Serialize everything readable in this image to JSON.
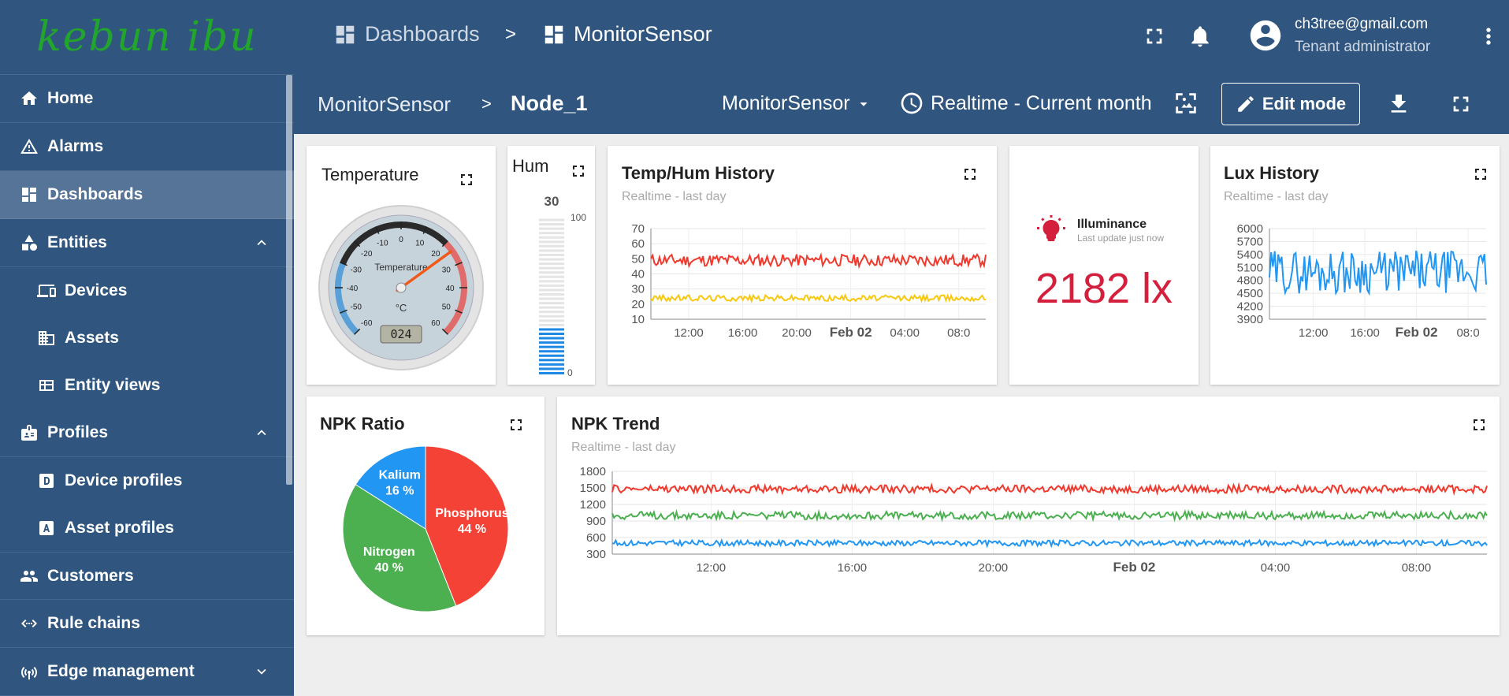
{
  "app": {
    "logo_text": "kebun ibu",
    "colors": {
      "primary": "#305680",
      "accent_red": "#d41f3d",
      "series_red": "#f03a2e",
      "series_yellow": "#f7c80e",
      "series_blue": "#2196f3",
      "series_green": "#4caf50"
    }
  },
  "sidebar": {
    "items": [
      {
        "label": "Home",
        "icon": "home-icon"
      },
      {
        "label": "Alarms",
        "icon": "warning-icon"
      },
      {
        "label": "Dashboards",
        "icon": "dashboard-icon"
      },
      {
        "label": "Entities",
        "icon": "entities-icon"
      },
      {
        "label": "Devices",
        "icon": "devices-icon"
      },
      {
        "label": "Assets",
        "icon": "assets-icon"
      },
      {
        "label": "Entity views",
        "icon": "entity-views-icon"
      },
      {
        "label": "Profiles",
        "icon": "profiles-icon"
      },
      {
        "label": "Device profiles",
        "icon": "device-profile-icon"
      },
      {
        "label": "Asset profiles",
        "icon": "asset-profile-icon"
      },
      {
        "label": "Customers",
        "icon": "customers-icon"
      },
      {
        "label": "Rule chains",
        "icon": "rule-chains-icon"
      },
      {
        "label": "Edge management",
        "icon": "edge-icon"
      }
    ]
  },
  "header": {
    "breadcrumb": [
      "Dashboards",
      ">",
      "MonitorSensor"
    ],
    "user_email": "ch3tree@gmail.com",
    "user_role": "Tenant administrator"
  },
  "dashboard_toolbar": {
    "title": "MonitorSensor",
    "separator": ">",
    "node": "Node_1",
    "state": "MonitorSensor",
    "timewindow": "Realtime - Current month",
    "edit_label": "Edit mode"
  },
  "widgets": {
    "temperature": {
      "title": "Temperature",
      "gauge_label": "Temperature",
      "unit": "°C",
      "value_display": "024",
      "value": 24,
      "min": -60,
      "max": 60,
      "ticks": [
        "-60",
        "-50",
        "-40",
        "-30",
        "-20",
        "-10",
        "0",
        "10",
        "20",
        "30",
        "40",
        "50",
        "60"
      ]
    },
    "humidity": {
      "title": "Hum",
      "value": 30,
      "value_label": "30",
      "max_label": "100",
      "min_label": "0"
    },
    "temp_hum_history": {
      "title": "Temp/Hum History",
      "subtitle": "Realtime - last day"
    },
    "illuminance": {
      "label": "Illuminance",
      "sub": "Last update just now",
      "value": "2182 lx"
    },
    "lux_history": {
      "title": "Lux History",
      "subtitle": "Realtime - last day"
    },
    "npk_ratio": {
      "title": "NPK Ratio"
    },
    "npk_trend": {
      "title": "NPK Trend",
      "subtitle": "Realtime - last day"
    }
  },
  "chart_data": [
    {
      "type": "line",
      "widget": "temp_hum_history",
      "y_ticks": [
        "70",
        "60",
        "50",
        "40",
        "30",
        "20",
        "10"
      ],
      "ylim": [
        10,
        70
      ],
      "x_ticks": [
        "12:00",
        "16:00",
        "20:00",
        "Feb 02",
        "04:00",
        "08:0"
      ],
      "grid": true,
      "series": [
        {
          "color": "#f03a2e",
          "mean": 49,
          "amp": 4
        },
        {
          "color": "#f7c80e",
          "mean": 24,
          "amp": 2
        }
      ]
    },
    {
      "type": "line",
      "widget": "lux_history",
      "y_ticks": [
        "6000",
        "5700",
        "5400",
        "5100",
        "4800",
        "4500",
        "4200",
        "3900"
      ],
      "ylim": [
        3900,
        6000
      ],
      "x_ticks": [
        "12:00",
        "16:00",
        "Feb 02",
        "08:0"
      ],
      "grid": true,
      "series": [
        {
          "color": "#2196f3",
          "mean": 5000,
          "amp": 500
        }
      ]
    },
    {
      "type": "pie",
      "widget": "npk_ratio",
      "slices": [
        {
          "label": "Phosphorus",
          "percent_label": "44 %",
          "value": 44,
          "color": "#f44336"
        },
        {
          "label": "Nitrogen",
          "percent_label": "40 %",
          "value": 40,
          "color": "#4caf50"
        },
        {
          "label": "Kalium",
          "percent_label": "16 %",
          "value": 16,
          "color": "#2196f3"
        }
      ]
    },
    {
      "type": "line",
      "widget": "npk_trend",
      "y_ticks": [
        "1800",
        "1500",
        "1200",
        "900",
        "600",
        "300"
      ],
      "ylim": [
        300,
        1800
      ],
      "x_ticks": [
        "12:00",
        "16:00",
        "20:00",
        "Feb 02",
        "04:00",
        "08:00"
      ],
      "grid": true,
      "series": [
        {
          "color": "#f03a2e",
          "mean": 1480,
          "amp": 70
        },
        {
          "color": "#4caf50",
          "mean": 1000,
          "amp": 70
        },
        {
          "color": "#2196f3",
          "mean": 500,
          "amp": 50
        }
      ]
    }
  ]
}
